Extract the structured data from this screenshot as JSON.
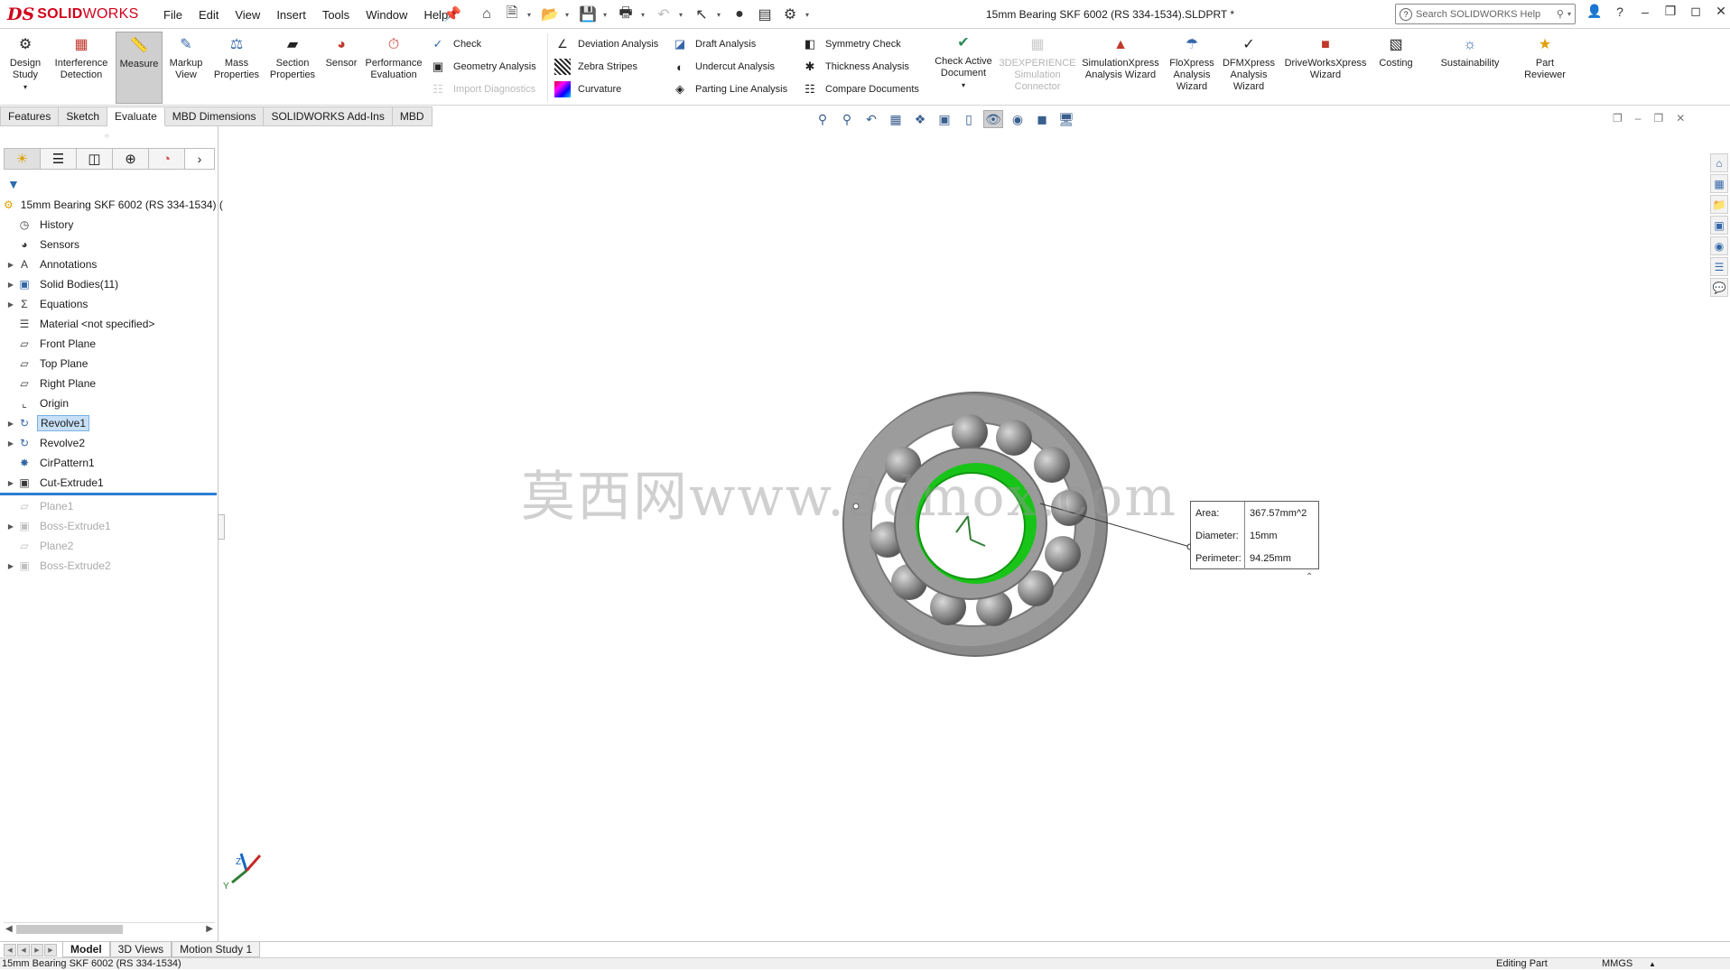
{
  "app": {
    "logo_ds": "DS",
    "logo_solid": "SOLID",
    "logo_works": "WORKS",
    "doc_title": "15mm Bearing SKF 6002 (RS 334-1534).SLDPRT *",
    "search_placeholder": "Search SOLIDWORKS Help",
    "menu": [
      "File",
      "Edit",
      "View",
      "Insert",
      "Tools",
      "Window",
      "Help"
    ]
  },
  "ribbon": {
    "design_study": "Design Study",
    "interference": "Interference Detection",
    "measure": "Measure",
    "markup": "Markup View",
    "mass": "Mass Properties",
    "section": "Section Properties",
    "sensor": "Sensor",
    "performance": "Performance Evaluation",
    "check": "Check",
    "geometry": "Geometry Analysis",
    "import_diag": "Import Diagnostics",
    "deviation": "Deviation Analysis",
    "zebra": "Zebra Stripes",
    "curvature": "Curvature",
    "draft": "Draft Analysis",
    "undercut": "Undercut Analysis",
    "parting": "Parting Line Analysis",
    "symmetry": "Symmetry Check",
    "thickness": "Thickness Analysis",
    "compare": "Compare Documents",
    "check_active": "Check Active Document",
    "experience": "3DEXPERIENCE Simulation Connector",
    "simxpress": "SimulationXpress Analysis Wizard",
    "floxpress": "FloXpress Analysis Wizard",
    "dfmxpress": "DFMXpress Analysis Wizard",
    "driveworks": "DriveWorksXpress Wizard",
    "costing": "Costing",
    "sustainability": "Sustainability",
    "part_reviewer": "Part Reviewer"
  },
  "command_tabs": [
    "Features",
    "Sketch",
    "Evaluate",
    "MBD Dimensions",
    "SOLIDWORKS Add-Ins",
    "MBD"
  ],
  "active_command_tab": "Evaluate",
  "tree": {
    "root": "15mm Bearing SKF 6002 (RS 334-1534)  (",
    "items": [
      {
        "label": "History"
      },
      {
        "label": "Sensors"
      },
      {
        "label": "Annotations"
      },
      {
        "label": "Solid Bodies(11)"
      },
      {
        "label": "Equations"
      },
      {
        "label": "Material <not specified>"
      },
      {
        "label": "Front Plane"
      },
      {
        "label": "Top Plane"
      },
      {
        "label": "Right Plane"
      },
      {
        "label": "Origin"
      },
      {
        "label": "Revolve1"
      },
      {
        "label": "Revolve2"
      },
      {
        "label": "CirPattern1"
      },
      {
        "label": "Cut-Extrude1"
      },
      {
        "label": "Plane1"
      },
      {
        "label": "Boss-Extrude1"
      },
      {
        "label": "Plane2"
      },
      {
        "label": "Boss-Extrude2"
      }
    ]
  },
  "callout": {
    "area_label": "Area:",
    "area_value": "367.57mm^2",
    "diameter_label": "Diameter:",
    "diameter_value": "15mm",
    "perimeter_label": "Perimeter:",
    "perimeter_value": "94.25mm"
  },
  "watermark": "莫西网www.3dmox.com",
  "bottom_tabs": [
    "Model",
    "3D Views",
    "Motion Study 1"
  ],
  "status": {
    "doc": "15mm Bearing SKF 6002 (RS 334-1534)",
    "editing": "Editing Part",
    "units": "MMGS"
  },
  "colors": {
    "brand_red": "#d0021b",
    "selection_green": "#19c419",
    "rollback_blue": "#2d7ed3"
  }
}
